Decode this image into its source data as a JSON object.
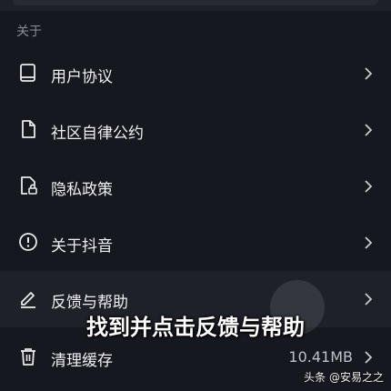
{
  "section": {
    "title": "关于"
  },
  "items": [
    {
      "label": "用户协议",
      "icon": "book-icon"
    },
    {
      "label": "社区自律公约",
      "icon": "document-icon"
    },
    {
      "label": "隐私政策",
      "icon": "privacy-lock-icon"
    },
    {
      "label": "关于抖音",
      "icon": "info-exclamation-icon"
    },
    {
      "label": "反馈与帮助",
      "icon": "pencil-icon"
    },
    {
      "label": "清理缓存",
      "icon": "trash-icon",
      "value": "10.41MB"
    }
  ],
  "caption": "找到并点击反馈与帮助",
  "watermark": "头条 @安易之之"
}
